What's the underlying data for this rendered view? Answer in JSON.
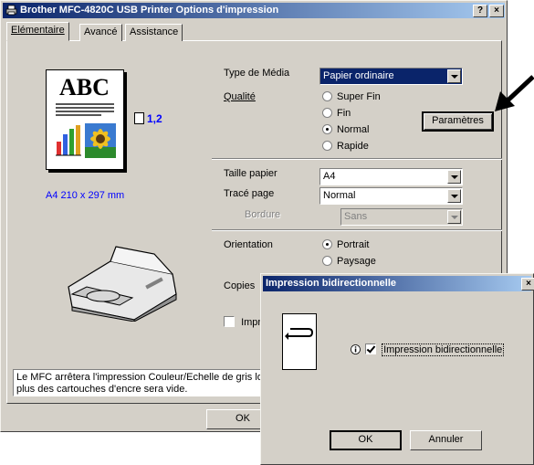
{
  "main_window": {
    "title": "Brother MFC-4820C USB Printer Options d'impression",
    "help_btn": "?",
    "close_btn": "×",
    "tabs": [
      {
        "label": "Elémentaire"
      },
      {
        "label": "Avancé"
      },
      {
        "label": "Assistance"
      }
    ],
    "preview": {
      "abc_text": "ABC",
      "copy_count": "1,2",
      "paper_info": "A4 210 x 297 mm"
    },
    "media_type": {
      "label": "Type de Média",
      "value": "Papier ordinaire"
    },
    "quality": {
      "label": "Qualité",
      "options": [
        {
          "label": "Super Fin"
        },
        {
          "label": "Fin"
        },
        {
          "label": "Normal"
        },
        {
          "label": "Rapide"
        }
      ],
      "selected": 2,
      "settings_button": "Paramètres"
    },
    "paper_size": {
      "label": "Taille papier",
      "value": "A4"
    },
    "page_layout": {
      "label": "Tracé page",
      "value": "Normal"
    },
    "border": {
      "label": "Bordure",
      "value": "Sans"
    },
    "orientation": {
      "label": "Orientation",
      "options": [
        {
          "label": "Portrait"
        },
        {
          "label": "Paysage"
        }
      ],
      "selected": 0
    },
    "copies_label": "Copies",
    "checkbox_partial": "Impr",
    "message": "Le MFC arrêtera l'impression Couleur/Echelle de gris lo\nplus des cartouches d'encre sera vide.",
    "ok_button": "OK"
  },
  "dialog": {
    "title": "Impression bidirectionnelle",
    "close_btn": "×",
    "checkbox_label": "Impression bidirectionnelle",
    "checkbox_checked": true,
    "ok_button": "OK",
    "cancel_button": "Annuler"
  },
  "colors": {
    "title_active": "#0a246a",
    "title_inactive": "#808080",
    "preview_text_blue": "#0000ff",
    "callout_arrow": "#000000"
  }
}
